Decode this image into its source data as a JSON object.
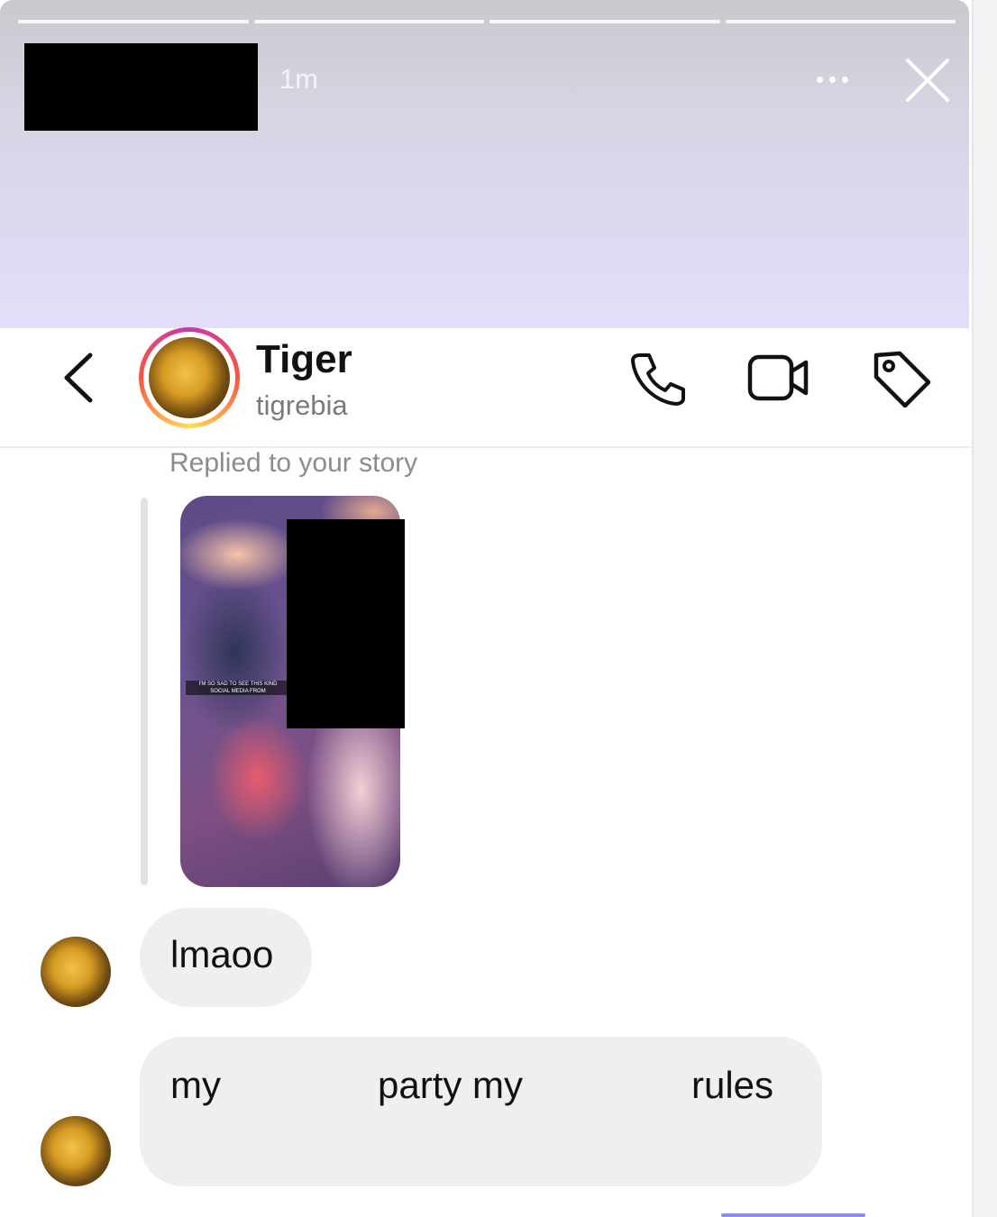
{
  "story": {
    "time_label": "1m",
    "segments": 4
  },
  "chat_header": {
    "display_name": "Tiger",
    "username": "tigrebia"
  },
  "conversation": {
    "reply_note": "Replied to your story",
    "story_caption_line1": "I'M SO SAD TO SEE THIS KIND",
    "story_caption_line2": "SOCIAL MEDIA FROM",
    "messages": [
      {
        "text": "lmaoo"
      },
      {
        "words": [
          "my",
          "party my",
          "rules"
        ]
      }
    ]
  },
  "colors": {
    "bubble_bg": "#efefef",
    "story_gradient_top": "#c9c9cf",
    "story_gradient_bottom": "#e3defa",
    "secondary_text": "#7a7a7e"
  },
  "icons": [
    "more-icon",
    "close-icon",
    "back-icon",
    "phone-icon",
    "video-icon",
    "tag-icon"
  ]
}
